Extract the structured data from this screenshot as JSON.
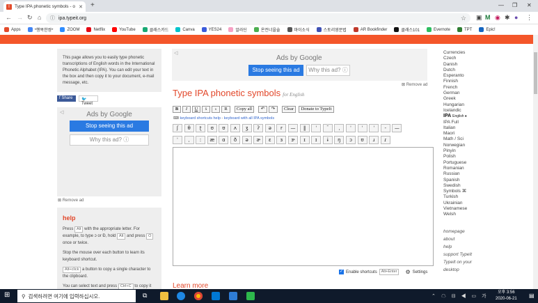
{
  "tab": {
    "title": "Type IPA phonetic symbols - o",
    "favicon": "I"
  },
  "address": {
    "url": "ipa.typeit.org"
  },
  "bookmarks": [
    {
      "label": "Apps",
      "color": "#e34b2b"
    },
    {
      "label": "*행복한쌍*",
      "color": "#4285f4"
    },
    {
      "label": "ZOOM",
      "color": "#2d8cff"
    },
    {
      "label": "Netflix",
      "color": "#e50914"
    },
    {
      "label": "YouTube",
      "color": "#ff0000"
    },
    {
      "label": "클래스카드",
      "color": "#19a974"
    },
    {
      "label": "Canva",
      "color": "#00c4cc"
    },
    {
      "label": "YES24",
      "color": "#3b5bdb"
    },
    {
      "label": "알라딘",
      "color": "#f7a1c4"
    },
    {
      "label": "온전너을술",
      "color": "#4caf50"
    },
    {
      "label": "마이소식",
      "color": "#555555"
    },
    {
      "label": "스토리영문법",
      "color": "#3f51b5"
    },
    {
      "label": "AR Bookfinder",
      "color": "#c0392b"
    },
    {
      "label": "클래스101",
      "color": "#111111"
    },
    {
      "label": "Evernote",
      "color": "#2dbe60"
    },
    {
      "label": "TPT",
      "color": "#2e7d32"
    },
    {
      "label": "Epic!",
      "color": "#1565c0"
    }
  ],
  "left": {
    "info_text": "This page allows you to easily type phonetic transcriptions of English words in the International Phonetic Alphabet (IPA). You can edit your text in the box and then copy it to your document, e-mail message, etc.",
    "share_label": "Share",
    "tweet_label": "Tweet",
    "ads_by": "Ads by",
    "google": "Google",
    "stop_label": "Stop seeing this ad",
    "why_label": "Why this ad? ⓘ",
    "remove_ad": "Remove ad"
  },
  "help": {
    "title": "help",
    "p1a": "Press",
    "key_alt": "Alt",
    "p1b": "with the appropriate letter. For example, to type ɔ or Đ, hold",
    "p1c": "and press",
    "key_o": "O",
    "p1d": "once or twice.",
    "p2": "Stop the mouse over each button to learn its keyboard shortcut.",
    "key_altclick": "Alt+click",
    "p3": "a button to copy a single character to the clipboard.",
    "p4a": "You can select text and press",
    "key_ctrlc": "Ctrl+C",
    "p4b": "to copy it"
  },
  "main": {
    "ads_by": "Ads by",
    "google": "Google",
    "stop_label": "Stop seeing this ad",
    "why_label": "Why this ad? ⓘ",
    "remove_ad": "Remove ad",
    "title": "Type IPA phonetic symbols",
    "subtitle": "for English",
    "toolbar": [
      "B",
      "I",
      "U",
      "S",
      "s",
      "R",
      "Copy all",
      "↶",
      "↷",
      "Clear",
      "Donate to TypeIt"
    ],
    "shortcut_link": "keyboard shortcuts help",
    "shortcut_sep": " - ",
    "shortcut_link2": "keyboard with all IPA symbols",
    "row1": [
      "ʃ",
      "θ",
      "ʈ",
      "ʊ",
      "ʊ",
      "ʌ",
      "ʒ",
      "ʔ",
      "ə",
      "r",
      "—",
      "‖",
      "ˈ",
      "ˉ",
      "ˌ",
      "ˈ",
      "ˈ",
      "ˈ",
      "-",
      "—"
    ],
    "row2": [
      "ˈ",
      "ˌ",
      "ː",
      "æ",
      "ɑ",
      "ð",
      "ə",
      "ɚ",
      "ɛ",
      "ɜ",
      "ɝ",
      "ɪ",
      "ɪ",
      "ɨ",
      "ŋ",
      "ɔ",
      "ʊ",
      "ɹ",
      "ɾ"
    ],
    "enable_label": "Enable shortcuts",
    "enable_key": "Alt+Enter",
    "settings_label": "Settings",
    "learn_more": "Learn more"
  },
  "sidebar": {
    "langs": [
      "Currencies",
      "Czech",
      "Danish",
      "Dutch",
      "Esperanto",
      "Finnish",
      "French",
      "German",
      "Greek",
      "Hungarian",
      "Icelandic"
    ],
    "ipa": "IPA",
    "ipa_sub": "English ♦",
    "langs2": [
      "IPA Full",
      "Italian",
      "Maori",
      "Math / Sci",
      "Norwegian",
      "Pinyin",
      "Polish",
      "Portuguese",
      "Romanian",
      "Russian",
      "Spanish",
      "Swedish",
      "Symbols ⌘",
      "Turkish",
      "Ukrainian",
      "Vietnamese",
      "Welsh"
    ],
    "links": [
      "homepage",
      "about",
      "help",
      "support TypeIt",
      "TypeIt on your desktop"
    ]
  },
  "taskbar": {
    "search_placeholder": "검색하려면 여기에 입력하십시오.",
    "time": "오후 3:56",
    "date": "2020-06-21"
  },
  "colors": {
    "accent": "#f4562a",
    "title": "#e2472a",
    "google_blue": "#2a7ae2"
  }
}
